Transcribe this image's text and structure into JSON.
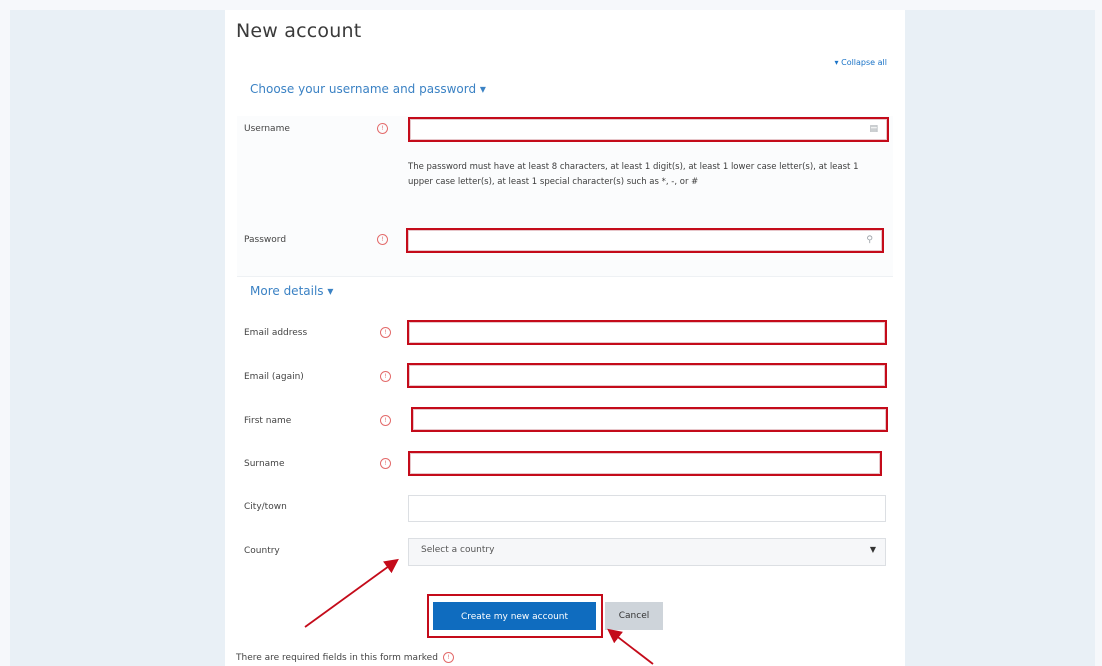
{
  "page": {
    "title": "New account",
    "collapse_all": "▾ Collapse all"
  },
  "sections": {
    "credentials": "Choose your username and password ▾",
    "details": "More details ▾"
  },
  "fields": {
    "username": {
      "label": "Username"
    },
    "password_policy": "The password must have at least 8 characters, at least 1 digit(s), at least 1 lower case letter(s), at least 1 upper case letter(s), at least 1 special character(s) such as *, -, or #",
    "password": {
      "label": "Password"
    },
    "email": {
      "label": "Email address"
    },
    "email_again": {
      "label": "Email (again)"
    },
    "firstname": {
      "label": "First name"
    },
    "surname": {
      "label": "Surname"
    },
    "city": {
      "label": "City/town"
    },
    "country": {
      "label": "Country",
      "value": "Select a country"
    }
  },
  "buttons": {
    "create": "Create my new account",
    "cancel": "Cancel"
  },
  "footer": {
    "required_note": "There are required fields in this form marked"
  },
  "colors": {
    "primary": "#0f6cbf",
    "error_border": "#c40b1a",
    "link": "#3b82c4"
  }
}
